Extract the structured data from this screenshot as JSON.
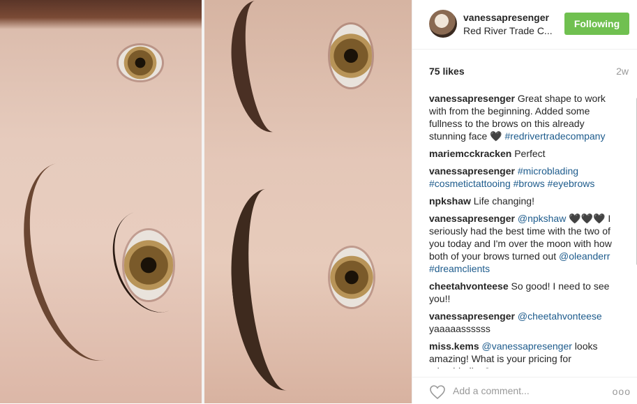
{
  "post": {
    "username": "vanessapresenger",
    "location": "Red River Trade C...",
    "follow_label": "Following",
    "likes": "75 likes",
    "age": "2w"
  },
  "comments": [
    {
      "user": "vanessapresenger",
      "parts": [
        {
          "t": "text",
          "v": " Great shape to work with from the beginning. Added some fullness to the brows on this already stunning face 🖤 "
        },
        {
          "t": "link",
          "v": "#redrivertradecompany"
        }
      ]
    },
    {
      "user": "mariemcckracken",
      "parts": [
        {
          "t": "text",
          "v": " Perfect"
        }
      ]
    },
    {
      "user": "vanessapresenger",
      "parts": [
        {
          "t": "text",
          "v": " "
        },
        {
          "t": "link",
          "v": "#microblading"
        },
        {
          "t": "text",
          "v": " "
        },
        {
          "t": "link",
          "v": "#cosmetictattooing"
        },
        {
          "t": "text",
          "v": " "
        },
        {
          "t": "link",
          "v": "#brows"
        },
        {
          "t": "text",
          "v": " "
        },
        {
          "t": "link",
          "v": "#eyebrows"
        }
      ]
    },
    {
      "user": "npkshaw",
      "parts": [
        {
          "t": "text",
          "v": " Life changing!"
        }
      ]
    },
    {
      "user": "vanessapresenger",
      "parts": [
        {
          "t": "text",
          "v": " "
        },
        {
          "t": "link",
          "v": "@npkshaw"
        },
        {
          "t": "text",
          "v": " 🖤🖤🖤 I seriously had the best time with the two of you today and I'm over the moon with how both of your brows turned out "
        },
        {
          "t": "link",
          "v": "@oleanderr"
        },
        {
          "t": "text",
          "v": " "
        },
        {
          "t": "link",
          "v": "#dreamclients"
        }
      ]
    },
    {
      "user": "cheetahvonteese",
      "parts": [
        {
          "t": "text",
          "v": " So good! I need to see you!!"
        }
      ]
    },
    {
      "user": "vanessapresenger",
      "parts": [
        {
          "t": "text",
          "v": " "
        },
        {
          "t": "link",
          "v": "@cheetahvonteese"
        },
        {
          "t": "text",
          "v": " yaaaaassssss"
        }
      ]
    },
    {
      "user": "miss.kems",
      "parts": [
        {
          "t": "text",
          "v": " "
        },
        {
          "t": "link",
          "v": "@vanessapresenger"
        },
        {
          "t": "text",
          "v": " looks amazing! What is your pricing for microblading?"
        }
      ]
    }
  ],
  "footer": {
    "comment_placeholder": "Add a comment...",
    "more_label": "ooo"
  },
  "icons": {
    "like": "heart-icon",
    "options": "more-options-icon"
  },
  "colors": {
    "follow_button": "#70c050",
    "link": "#1d5b8c",
    "muted": "#999999"
  }
}
